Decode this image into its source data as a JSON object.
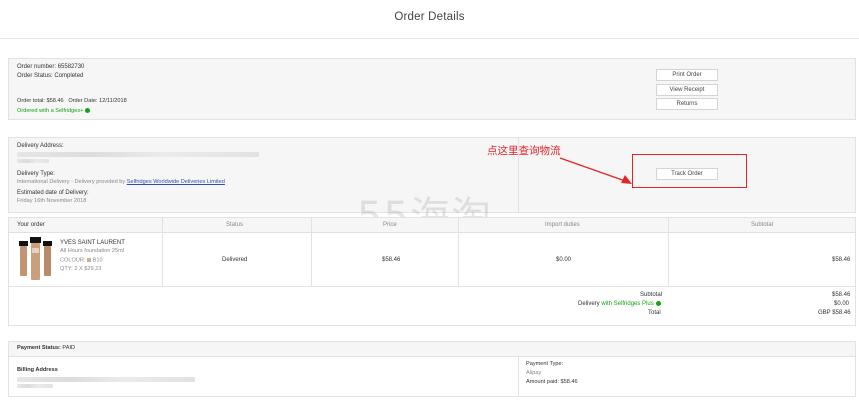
{
  "page": {
    "title": "Order Details"
  },
  "order": {
    "number_label": "Order number:",
    "number": "65582730",
    "status_label": "Order Status:",
    "status": "Completed",
    "total_label": "Order total:",
    "total": "$58.46",
    "date_label": "Order Date:",
    "date": "12/11/2018",
    "ordered_with": "Ordered with a Selfridges+",
    "buttons": {
      "print": "Print Order",
      "receipt": "View Receipt",
      "returns": "Returns"
    }
  },
  "delivery": {
    "address_label": "Delivery Address:",
    "type_label": "Delivery Type:",
    "type_prefix": "International Delivery - Delivery provided by",
    "type_link": "Selfridges Worldwide Deliveries Limited",
    "estimated_label": "Estimated date of Delivery:",
    "estimated_value": "Friday 16th November 2018",
    "track_button": "Track Order",
    "annotation": "点这里查询物流"
  },
  "items_table": {
    "headers": [
      "Your order",
      "Status",
      "Price",
      "Import duties",
      "Subtotal"
    ],
    "item": {
      "brand": "YVES SAINT LAURENT",
      "name": "All Hours foundation 25ml",
      "colour_label": "COLOUR:",
      "colour_value": "B10",
      "qty_label": "QTY:",
      "qty_value": "2 X $29.23",
      "status": "Delivered",
      "price": "$58.46",
      "import_duties": "$0.00",
      "subtotal": "$58.46"
    }
  },
  "totals": {
    "subtotal_label": "Subtotal",
    "subtotal_value": "$58.46",
    "delivery_label": "Delivery",
    "delivery_with": "with Selfridges Plus",
    "delivery_value": "$0.00",
    "total_label": "Total",
    "total_value": "GBP $58.46"
  },
  "payment": {
    "status_label": "Payment Status:",
    "status_value": "PAID",
    "billing_label": "Billing Address",
    "type_label": "Payment Type:",
    "type_value": "Alipay",
    "amount_label": "Amount paid:",
    "amount_value": "$58.46"
  },
  "watermark": "55海淘",
  "colors": {
    "green": "#18a018",
    "annotation_red": "#e0262a",
    "link_blue": "#2a4fb0"
  }
}
